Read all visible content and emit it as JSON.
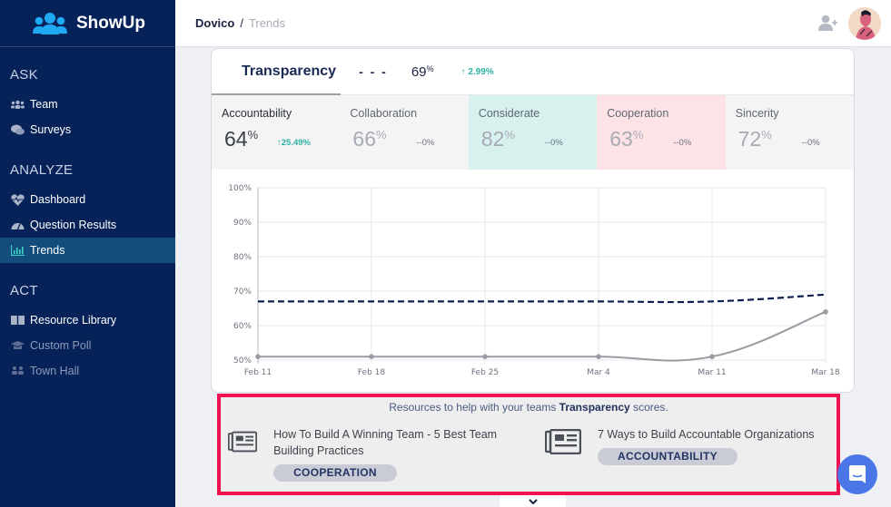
{
  "app": {
    "name": "ShowUp"
  },
  "sidebar": {
    "sections": [
      {
        "title": "ASK",
        "items": [
          {
            "label": "Team",
            "icon": "team-icon",
            "state": "normal"
          },
          {
            "label": "Surveys",
            "icon": "chat-bubbles-icon",
            "state": "normal"
          }
        ]
      },
      {
        "title": "ANALYZE",
        "items": [
          {
            "label": "Dashboard",
            "icon": "heart-pulse-icon",
            "state": "normal"
          },
          {
            "label": "Question Results",
            "icon": "gauge-icon",
            "state": "normal"
          },
          {
            "label": "Trends",
            "icon": "bar-chart-icon",
            "state": "active"
          }
        ]
      },
      {
        "title": "ACT",
        "items": [
          {
            "label": "Resource Library",
            "icon": "book-icon",
            "state": "normal"
          },
          {
            "label": "Custom Poll",
            "icon": "graduation-cap-icon",
            "state": "muted"
          },
          {
            "label": "Town Hall",
            "icon": "group-icon",
            "state": "muted"
          }
        ]
      }
    ]
  },
  "topbar": {
    "breadcrumb": {
      "root": "Dovico",
      "separator": "/",
      "current": "Trends"
    }
  },
  "trend_card": {
    "title": "Transparency",
    "legend_dash": "- - -",
    "value": "69",
    "value_unit": "%",
    "change": "2.99%",
    "change_direction": "up",
    "metrics": [
      {
        "label": "Accountability",
        "value": "64",
        "unit": "%",
        "change": "25.49%",
        "change_direction": "up",
        "selected": true,
        "tint": "gray"
      },
      {
        "label": "Collaboration",
        "value": "66",
        "unit": "%",
        "change": "--0%",
        "selected": false,
        "tint": "gray"
      },
      {
        "label": "Considerate",
        "value": "82",
        "unit": "%",
        "change": "--0%",
        "selected": false,
        "tint": "green"
      },
      {
        "label": "Cooperation",
        "value": "63",
        "unit": "%",
        "change": "--0%",
        "selected": false,
        "tint": "red"
      },
      {
        "label": "Sincerity",
        "value": "72",
        "unit": "%",
        "change": "--0%",
        "selected": false,
        "tint": "gray"
      }
    ]
  },
  "chart_data": {
    "type": "line",
    "title": "",
    "xlabel": "",
    "ylabel": "",
    "x": [
      "Feb 11",
      "Feb 18",
      "Feb 25",
      "Mar 4",
      "Mar 11",
      "Mar 18"
    ],
    "yticks": [
      "50%",
      "60%",
      "70%",
      "80%",
      "90%",
      "100%"
    ],
    "ylim": [
      50,
      100
    ],
    "grid": true,
    "series": [
      {
        "name": "Transparency",
        "style": "dashed",
        "color": "#0d1f4f",
        "values": [
          67,
          67,
          67,
          67,
          67,
          69
        ]
      },
      {
        "name": "Accountability",
        "style": "solid",
        "color": "#9a9ca3",
        "values": [
          51,
          51,
          51,
          51,
          51,
          64
        ]
      }
    ]
  },
  "resources": {
    "heading_prefix": "Resources to help with your teams",
    "heading_topic": "Transparency",
    "heading_suffix": "scores.",
    "items": [
      {
        "title": "How To Build A Winning Team - 5 Best Team Building Practices",
        "tag": "COOPERATION",
        "icon": "newspaper-icon"
      },
      {
        "title": "7 Ways to Build Accountable Organizations",
        "tag": "ACCOUNTABILITY",
        "icon": "newspaper-icon"
      }
    ]
  },
  "colors": {
    "sidebar_bg": "#062259",
    "sidebar_active": "#124d7d",
    "accent_teal": "#2fb3a4",
    "highlight_border": "#f0134f",
    "chat_button": "#4a76e8"
  }
}
